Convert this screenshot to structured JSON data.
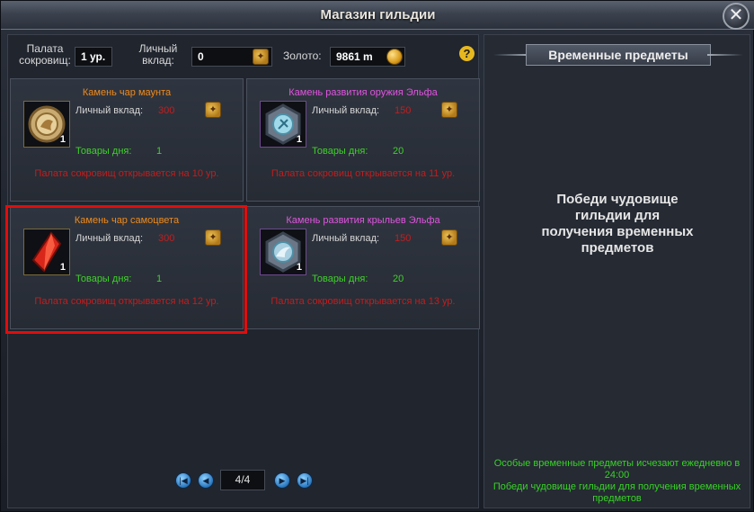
{
  "window": {
    "title": "Магазин гильдии",
    "close_glyph": "✕"
  },
  "header": {
    "treasury_label_line1": "Палата",
    "treasury_label_line2": "сокровищ:",
    "treasury_value": "1 ур.",
    "contribution_label_line1": "Личный",
    "contribution_label_line2": "вклад:",
    "contribution_value": "0",
    "gold_label": "Золото:",
    "gold_value": "9861 m",
    "help_glyph": "?"
  },
  "items": [
    {
      "name": "Камень чар маунта",
      "name_color": "orange",
      "icon": "mount-enchant-stone-icon",
      "qty": "1",
      "contribution_label": "Личный вклад:",
      "contribution_value": "300",
      "daily_label": "Товары дня:",
      "daily_value": "1",
      "unlock_text": "Палата сокровищ открывается на 10 ур."
    },
    {
      "name": "Камень развития оружия Эльфа",
      "name_color": "pink",
      "icon": "elf-weapon-stone-icon",
      "qty": "1",
      "contribution_label": "Личный вклад:",
      "contribution_value": "150",
      "daily_label": "Товары дня:",
      "daily_value": "20",
      "unlock_text": "Палата сокровищ открывается на 11 ур."
    },
    {
      "name": "Камень чар самоцвета",
      "name_color": "orange",
      "icon": "gem-enchant-stone-icon",
      "qty": "1",
      "contribution_label": "Личный вклад:",
      "contribution_value": "300",
      "daily_label": "Товары дня:",
      "daily_value": "1",
      "unlock_text": "Палата сокровищ открывается на 12 ур."
    },
    {
      "name": "Камень развития крыльев Эльфа",
      "name_color": "pink",
      "icon": "elf-wings-stone-icon",
      "qty": "1",
      "contribution_label": "Личный вклад:",
      "contribution_value": "150",
      "daily_label": "Товары дня:",
      "daily_value": "20",
      "unlock_text": "Палата сокровищ открывается на 13 ур."
    }
  ],
  "pagination": {
    "first_glyph": "|◀",
    "prev_glyph": "◀",
    "next_glyph": "▶",
    "last_glyph": "▶|",
    "page": "4/4"
  },
  "right_panel": {
    "title": "Временные предметы",
    "message": "Победи чудовище гильдии для получения временных предметов",
    "footer_line1": "Особые временные предметы исчезают ежедневно в 24:00",
    "footer_line2": "Победи чудовище гильдии для получения временных предметов"
  },
  "colors": {
    "orange_name": "#f08a1a",
    "pink_name": "#e155e0",
    "red_value": "#c41d1d",
    "green_text": "#3fd12a",
    "highlight": "#e00d0d"
  }
}
